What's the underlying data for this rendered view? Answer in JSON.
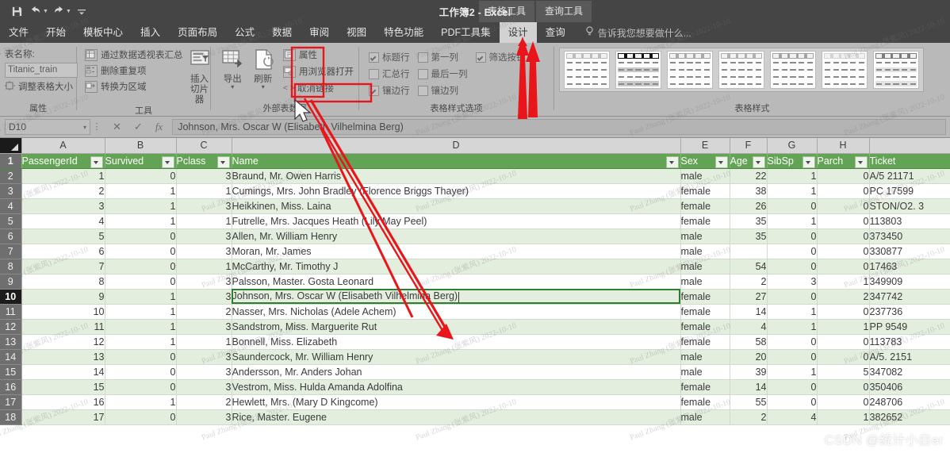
{
  "titlebar": {
    "quick_access": [
      {
        "name": "save-icon",
        "label": "保存"
      },
      {
        "name": "undo-icon",
        "label": "撤消"
      },
      {
        "name": "redo-icon",
        "label": "恢复"
      },
      {
        "name": "customize-qat-icon",
        "label": "自定义快速访问工具栏"
      }
    ],
    "context_tabs": [
      "表格工具",
      "查询工具"
    ],
    "document_title": "工作簿2 - Excel"
  },
  "tabs": [
    {
      "label": "文件",
      "active": false
    },
    {
      "label": "开始",
      "active": false
    },
    {
      "label": "模板中心",
      "active": false
    },
    {
      "label": "插入",
      "active": false
    },
    {
      "label": "页面布局",
      "active": false
    },
    {
      "label": "公式",
      "active": false
    },
    {
      "label": "数据",
      "active": false
    },
    {
      "label": "审阅",
      "active": false
    },
    {
      "label": "视图",
      "active": false
    },
    {
      "label": "特色功能",
      "active": false
    },
    {
      "label": "PDF工具集",
      "active": false
    },
    {
      "label": "设计",
      "active": true
    },
    {
      "label": "查询",
      "active": false
    }
  ],
  "tell_me": "告诉我您想要做什么...",
  "ribbon": {
    "groups": [
      {
        "title": "属性",
        "table_name_label": "表名称:",
        "table_name_value": "Titanic_train",
        "resize_label": "调整表格大小"
      },
      {
        "title": "工具",
        "items": [
          {
            "label": "通过数据透视表汇总",
            "icon": "pivot-table-icon"
          },
          {
            "label": "删除重复项",
            "icon": "remove-duplicates-icon"
          },
          {
            "label": "转换为区域",
            "icon": "convert-to-range-icon"
          }
        ],
        "slicer_label_line1": "插入",
        "slicer_label_line2": "切片器",
        "slicer_icon": "insert-slicer-icon"
      },
      {
        "title": "外部表数据",
        "export_label": "导出",
        "export_icon": "export-icon",
        "refresh_label": "刷新",
        "refresh_icon": "refresh-icon",
        "small_items": [
          {
            "label": "属性",
            "icon": "properties-icon"
          },
          {
            "label": "用浏览器打开",
            "icon": "open-in-browser-icon"
          },
          {
            "label": "取消链接",
            "icon": "unlink-icon"
          }
        ]
      },
      {
        "title": "表格样式选项",
        "checkboxes": [
          {
            "label": "标题行",
            "checked": true
          },
          {
            "label": "汇总行",
            "checked": false
          },
          {
            "label": "镶边行",
            "checked": true
          },
          {
            "label": "第一列",
            "checked": false
          },
          {
            "label": "最后一列",
            "checked": false
          },
          {
            "label": "镶边列",
            "checked": false
          },
          {
            "label": "筛选按钮",
            "checked": true
          }
        ]
      },
      {
        "title": "表格样式",
        "swatch_count": 7
      }
    ]
  },
  "formula_bar": {
    "name_box": "D10",
    "cancel_icon": "cancel-icon",
    "enter_icon": "enter-icon",
    "fx_icon": "function-icon",
    "value": "Johnson, Mrs. Oscar W (Elisabeth Vilhelmina Berg)"
  },
  "grid": {
    "column_letters": [
      "A",
      "B",
      "C",
      "D",
      "E",
      "F",
      "G",
      "H",
      ""
    ],
    "selected_cell": "D10",
    "selected_row_number": "10",
    "headers": [
      "PassengerId",
      "Survived",
      "Pclass",
      "Name",
      "Sex",
      "Age",
      "SibSp",
      "Parch",
      "Ticket"
    ],
    "header_row_number": "1",
    "rows": [
      {
        "n": "2",
        "cells": [
          "1",
          "0",
          "3",
          "Braund, Mr. Owen Harris",
          "male",
          "22",
          "1",
          "0",
          "A/5 21171"
        ]
      },
      {
        "n": "3",
        "cells": [
          "2",
          "1",
          "1",
          "Cumings, Mrs. John Bradley (Florence Briggs Thayer)",
          "female",
          "38",
          "1",
          "0",
          "PC 17599"
        ]
      },
      {
        "n": "4",
        "cells": [
          "3",
          "1",
          "3",
          "Heikkinen, Miss. Laina",
          "female",
          "26",
          "0",
          "0",
          "STON/O2. 3"
        ]
      },
      {
        "n": "5",
        "cells": [
          "4",
          "1",
          "1",
          "Futrelle, Mrs. Jacques Heath (Lily May Peel)",
          "female",
          "35",
          "1",
          "0",
          "113803"
        ]
      },
      {
        "n": "6",
        "cells": [
          "5",
          "0",
          "3",
          "Allen, Mr. William Henry",
          "male",
          "35",
          "0",
          "0",
          "373450"
        ]
      },
      {
        "n": "7",
        "cells": [
          "6",
          "0",
          "3",
          "Moran, Mr. James",
          "male",
          "",
          "0",
          "0",
          "330877"
        ]
      },
      {
        "n": "8",
        "cells": [
          "7",
          "0",
          "1",
          "McCarthy, Mr. Timothy J",
          "male",
          "54",
          "0",
          "0",
          "17463"
        ]
      },
      {
        "n": "9",
        "cells": [
          "8",
          "0",
          "3",
          "Palsson, Master. Gosta Leonard",
          "male",
          "2",
          "3",
          "1",
          "349909"
        ]
      },
      {
        "n": "10",
        "cells": [
          "9",
          "1",
          "3",
          "Johnson, Mrs. Oscar W (Elisabeth Vilhelmina Berg)",
          "female",
          "27",
          "0",
          "2",
          "347742"
        ]
      },
      {
        "n": "11",
        "cells": [
          "10",
          "1",
          "2",
          "Nasser, Mrs. Nicholas (Adele Achem)",
          "female",
          "14",
          "1",
          "0",
          "237736"
        ]
      },
      {
        "n": "12",
        "cells": [
          "11",
          "1",
          "3",
          "Sandstrom, Miss. Marguerite Rut",
          "female",
          "4",
          "1",
          "1",
          "PP 9549"
        ]
      },
      {
        "n": "13",
        "cells": [
          "12",
          "1",
          "1",
          "Bonnell, Miss. Elizabeth",
          "female",
          "58",
          "0",
          "0",
          "113783"
        ]
      },
      {
        "n": "14",
        "cells": [
          "13",
          "0",
          "3",
          "Saundercock, Mr. William Henry",
          "male",
          "20",
          "0",
          "0",
          "A/5. 2151"
        ]
      },
      {
        "n": "15",
        "cells": [
          "14",
          "0",
          "3",
          "Andersson, Mr. Anders Johan",
          "male",
          "39",
          "1",
          "5",
          "347082"
        ]
      },
      {
        "n": "16",
        "cells": [
          "15",
          "0",
          "3",
          "Vestrom, Miss. Hulda Amanda Adolfina",
          "female",
          "14",
          "0",
          "0",
          "350406"
        ]
      },
      {
        "n": "17",
        "cells": [
          "16",
          "1",
          "2",
          "Hewlett, Mrs. (Mary D Kingcome)",
          "female",
          "55",
          "0",
          "0",
          "248706"
        ]
      },
      {
        "n": "18",
        "cells": [
          "17",
          "0",
          "3",
          "Rice, Master. Eugene",
          "male",
          "2",
          "4",
          "1",
          "382652"
        ]
      }
    ]
  },
  "annotations": {
    "color": "#e8161a",
    "highlight_boxes": [
      "refresh-button",
      "unlink-button"
    ],
    "arrows": [
      "arrow-to-design-tab",
      "arrow-to-filter-button",
      "arrow-from-refresh-to-cell"
    ]
  },
  "watermarks": {
    "text": "Paul Zhang (张紫风)  2022-10-10",
    "csdn": "CSDN @统计小白er"
  },
  "colors": {
    "ribbon_bg": "#b9b9b9",
    "titlebar_bg": "#454545",
    "table_header_green": "#63a355",
    "band_green": "#e3eede",
    "annotation_red": "#e8161a"
  }
}
